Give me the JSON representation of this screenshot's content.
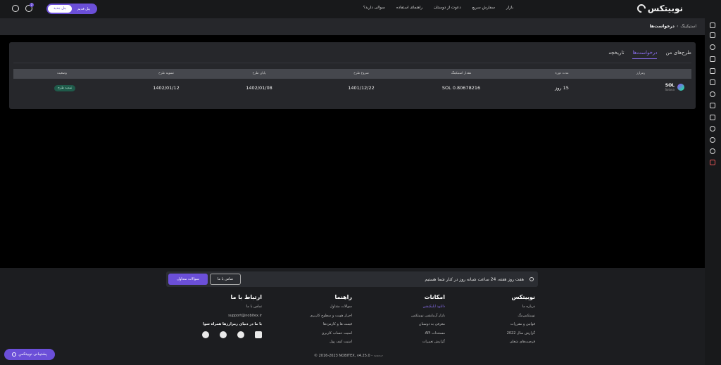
{
  "header": {
    "brand": "نوبیتکس",
    "nav": [
      "بازار",
      "سفارش سریع",
      "دعوت از دوستان",
      "راهنمای استفاده",
      "سوالی دارید؟"
    ],
    "toggle_new": "پنل جدید",
    "toggle_old": "پنل قدیم",
    "notification_count": "2"
  },
  "breadcrumb": {
    "parent": "استیکینگ",
    "separator": "›",
    "current": "درخواست‌ها"
  },
  "tabs": {
    "items": [
      "طرح‌های من",
      "درخواست‌ها",
      "تاریخچه"
    ],
    "active": "درخواست‌ها"
  },
  "table": {
    "headers": [
      "رمزارز",
      "مدت دوره",
      "مقدار استیکینگ",
      "شروع طرح",
      "پایان طرح",
      "تسویه طرح",
      "وضعیت"
    ],
    "row": {
      "symbol": "SOL",
      "name": "Solana",
      "duration": "15 روز",
      "amount": "0.80678216 SOL",
      "start": "1401/12/22",
      "end": "1402/01/08",
      "settle": "1402/01/12",
      "status": "تمدید طرح"
    }
  },
  "footer": {
    "cta_text": "هفت روز هفته، 24 ساعت شبانه روز در کنار شما هستیم",
    "contact_button": "تماس با ما",
    "faq_button": "سوالات متداول",
    "col_nobitex": {
      "title": "نوبیتکس",
      "links": [
        "درباره ما",
        "نوبیتکس‌مگ",
        "قوانین و مقررات",
        "گزارش سال 2022",
        "فرصت‌های شغلی"
      ]
    },
    "col_features": {
      "title": "امکانات",
      "links": [
        "دانلود اپلیکیشن",
        "بازار آزمایشی نوبیتکس",
        "معرفی به دوستان",
        "مستندات API",
        "گزارش تغییرات"
      ]
    },
    "col_guide": {
      "title": "راهنما",
      "links": [
        "سوالات متداول",
        "احراز هویت و سطوح کاربری",
        "قیمت ها و کارمزدها",
        "امنیت حساب کاربری",
        "امنیت کیف پول"
      ]
    },
    "col_contact": {
      "title": "ارتباط با ما",
      "links": [
        "تماس با ما",
        "support@nobitex.ir"
      ],
      "social_title": "با ما در دنیای رمزارزها همراه شوا"
    },
    "copyright": "© 2016-2023 NOBITEX, v4.25.0 -",
    "version_hash": "3e9b5a7"
  },
  "support_button": "پشتیبانی نوبیتکس",
  "colors": {
    "accent": "#6b4fd8",
    "background": "#000000",
    "panel": "#26272b",
    "status_bg": "#1f5a4a"
  }
}
